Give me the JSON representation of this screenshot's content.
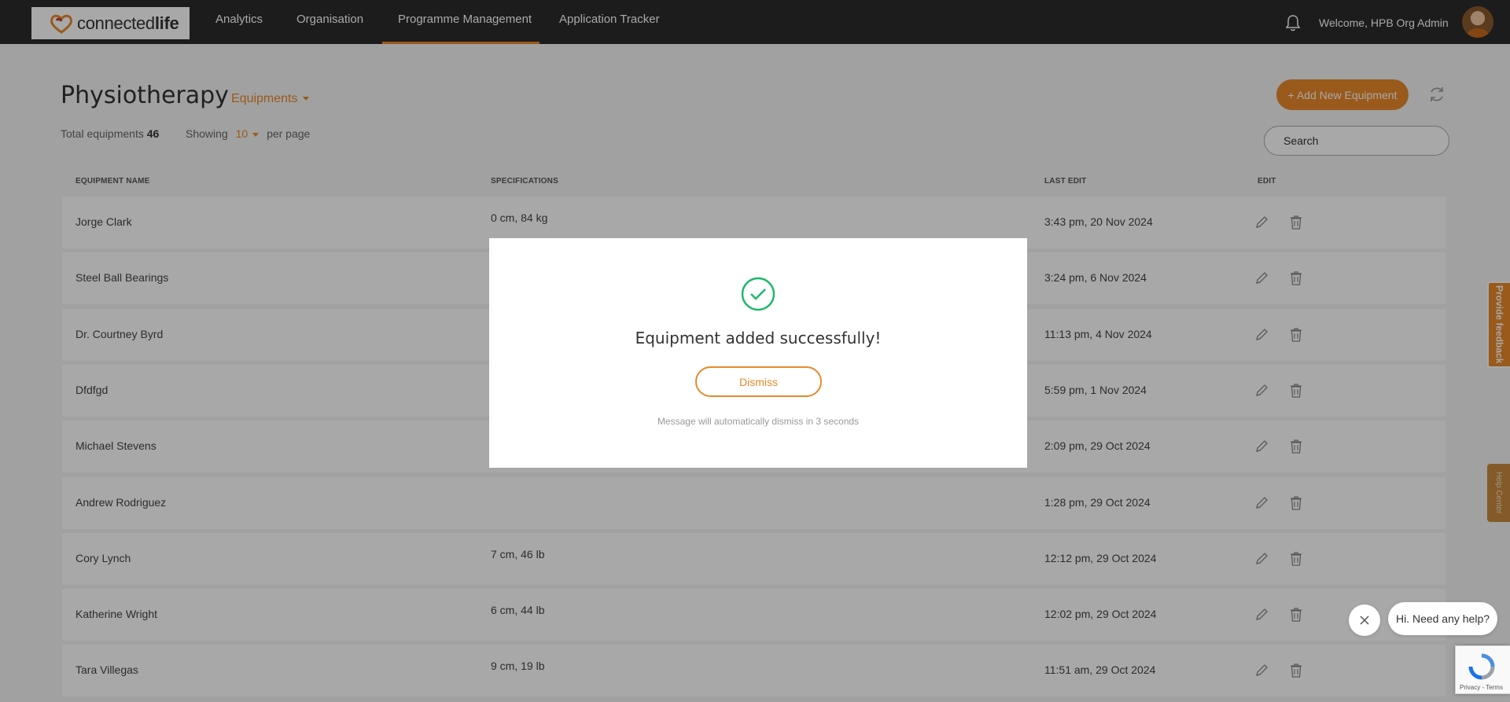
{
  "nav": {
    "logo_light": "connected",
    "logo_bold": "life",
    "items": [
      "Analytics",
      "Organisation",
      "Programme Management",
      "Application Tracker"
    ],
    "welcome": "Welcome, HPB Org Admin",
    "accent": "#e8892a"
  },
  "page": {
    "title": "Physiotherapy",
    "category": "Equipments",
    "total_label": "Total equipments",
    "total_count": "46",
    "showing_label": "Showing",
    "per_page_value": "10",
    "per_page_label": "per page",
    "add_button": "+ Add New Equipment",
    "search_placeholder": "Search"
  },
  "table": {
    "headers": [
      "EQUIPMENT NAME",
      "SPECIFICATIONS",
      "LAST EDIT",
      "EDIT"
    ],
    "rows": [
      {
        "name": "Jorge Clark",
        "spec": "0 cm, 84 kg",
        "date": "3:43 pm, 20 Nov 2024"
      },
      {
        "name": "Steel Ball Bearings",
        "spec": "",
        "date": "3:24 pm, 6 Nov 2024"
      },
      {
        "name": "Dr. Courtney Byrd",
        "spec": "",
        "date": "11:13 pm, 4 Nov 2024"
      },
      {
        "name": "Dfdfgd",
        "spec": "",
        "date": "5:59 pm, 1 Nov 2024"
      },
      {
        "name": "Michael Stevens",
        "spec": "",
        "date": "2:09 pm, 29 Oct 2024"
      },
      {
        "name": "Andrew Rodriguez",
        "spec": "",
        "date": "1:28 pm, 29 Oct 2024"
      },
      {
        "name": "Cory Lynch",
        "spec": "7 cm, 46 lb",
        "date": "12:12 pm, 29 Oct 2024"
      },
      {
        "name": "Katherine Wright",
        "spec": "6 cm, 44 lb",
        "date": "12:02 pm, 29 Oct 2024"
      },
      {
        "name": "Tara Villegas",
        "spec": "9 cm, 19 lb",
        "date": "11:51 am, 29 Oct 2024"
      }
    ]
  },
  "modal": {
    "message": "Equipment added successfully!",
    "dismiss": "Dismiss",
    "auto_note": "Message will automatically dismiss in 3 seconds",
    "success_color": "#1db86a"
  },
  "side": {
    "feedback": "Provide feedback",
    "help_center": "Help Center"
  },
  "chat": {
    "prompt": "Hi. Need any help?"
  },
  "recaptcha": {
    "terms": "Privacy - Terms"
  }
}
